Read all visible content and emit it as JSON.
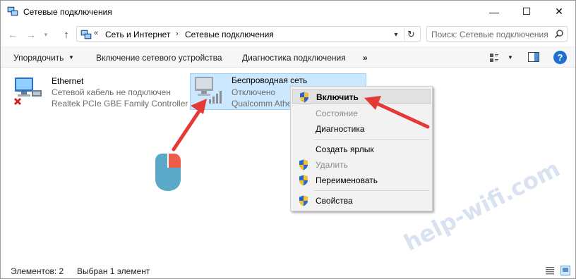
{
  "window": {
    "title": "Сетевые подключения",
    "controls": {
      "minimize": "—",
      "maximize": "☐",
      "close": "✕"
    }
  },
  "nav": {
    "back_icon": "←",
    "forward_icon": "→",
    "recent_icon": "▾",
    "up_icon": "↑",
    "address": {
      "overflow": "«",
      "parts": [
        "Сеть и Интернет",
        "Сетевые подключения"
      ],
      "separator": "›",
      "dropdown_icon": "▾",
      "refresh_icon": "↻"
    },
    "search": {
      "placeholder": "Поиск: Сетевые подключения"
    }
  },
  "command_bar": {
    "arrange": "Упорядочить",
    "arrange_caret": "▼",
    "enable_device": "Включение сетевого устройства",
    "diagnostics": "Диагностика подключения",
    "more": "»",
    "view_caret": "▼",
    "help": "?"
  },
  "connections": [
    {
      "name": "Ethernet",
      "status": "Сетевой кабель не подключен",
      "adapter": "Realtek PCIe GBE Family Controller",
      "icon": "wired-network-disconnected-icon"
    },
    {
      "name": "Беспроводная сеть",
      "status": "Отключено",
      "adapter": "Qualcomm Atheros",
      "icon": "wireless-network-icon",
      "selected": true
    }
  ],
  "context_menu": {
    "items": [
      {
        "label": "Включить",
        "shield": true,
        "default": true,
        "disabled": false
      },
      {
        "label": "Состояние",
        "shield": false,
        "disabled": true
      },
      {
        "label": "Диагностика",
        "shield": false,
        "disabled": false
      },
      {
        "label": "Создать ярлык",
        "shield": false,
        "disabled": false
      },
      {
        "label": "Удалить",
        "shield": true,
        "disabled": true
      },
      {
        "label": "Переименовать",
        "shield": true,
        "disabled": false
      },
      {
        "label": "Свойства",
        "shield": true,
        "disabled": false
      }
    ]
  },
  "status_bar": {
    "count": "Элементов: 2",
    "selection": "Выбран 1 элемент"
  },
  "watermark": "help-wifi.com",
  "colors": {
    "selection_bg": "#cce8ff",
    "selection_border": "#99d1ff",
    "arrow": "#e53935",
    "mouse_body": "#5aa9c8",
    "mouse_button": "#ef5b4b",
    "shield_blue": "#2a64c8",
    "shield_yellow": "#f2c230"
  }
}
